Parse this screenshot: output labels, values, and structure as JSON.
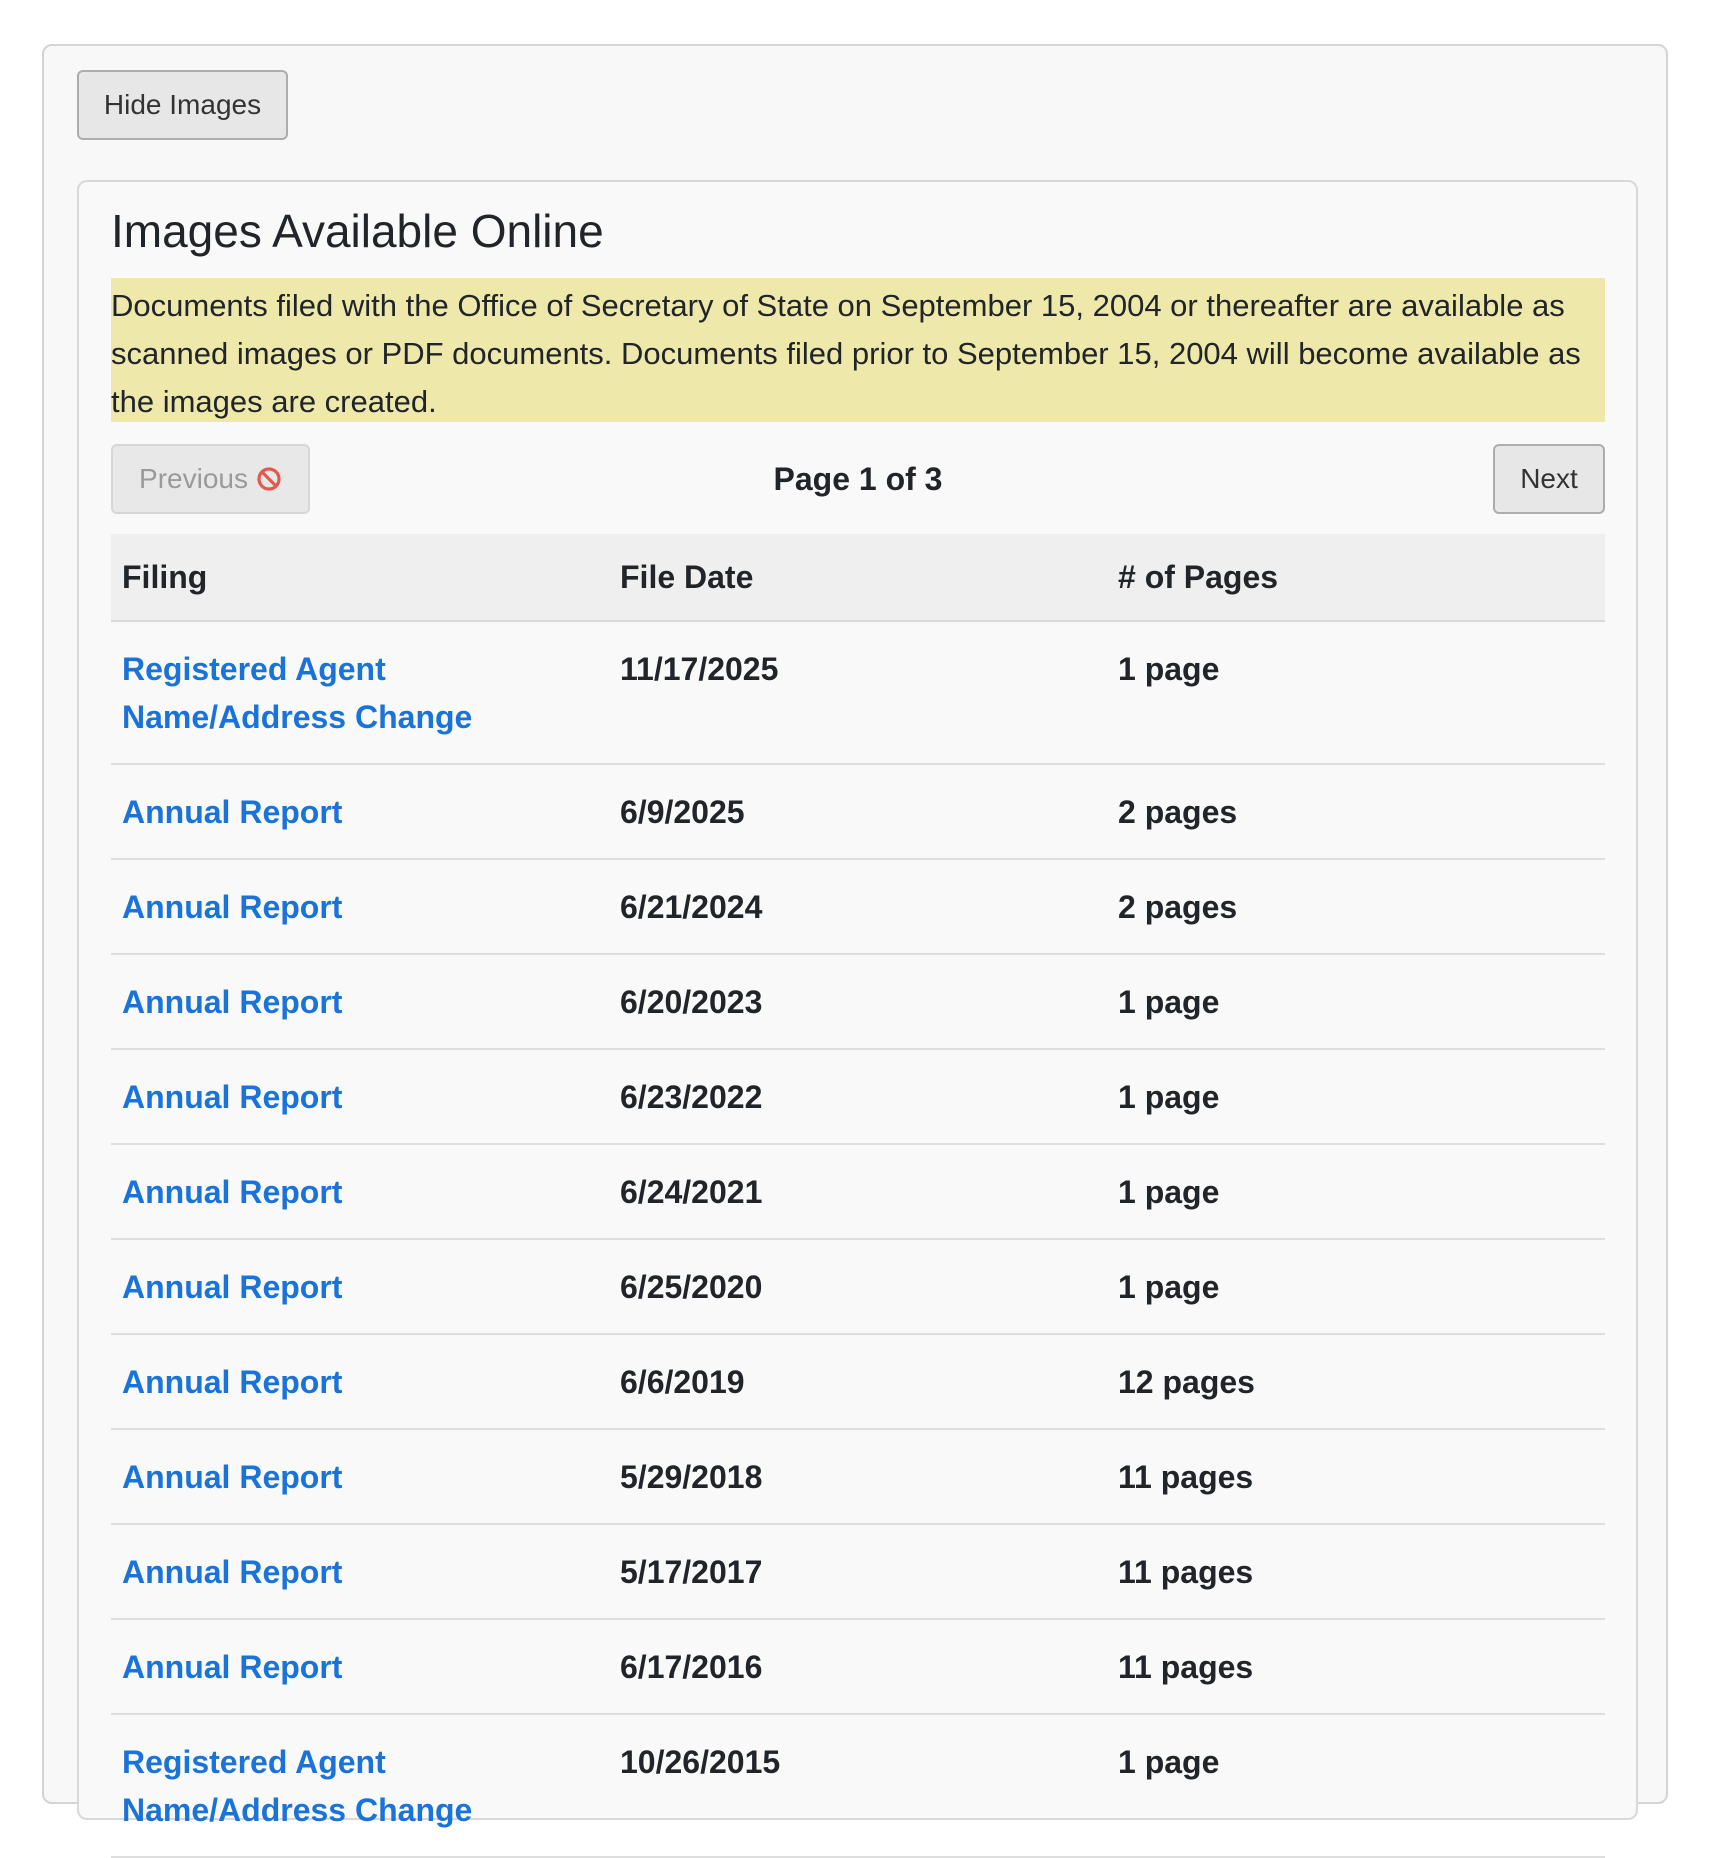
{
  "toolbar": {
    "hide_images_label": "Hide Images"
  },
  "card": {
    "title": "Images Available Online",
    "notice": "Documents filed with the Office of Secretary of State on September 15, 2004 or thereafter are available as scanned images or PDF documents. Documents filed prior to September 15, 2004 will become available as the images are created."
  },
  "pagination": {
    "previous_label": "Previous",
    "previous_icon": "prohibited-icon",
    "page_text": "Page 1 of 3",
    "next_label": "Next"
  },
  "colors": {
    "link": "#1a73d9",
    "notice_bg": "#eee8aa",
    "prohibited": "#e05a4f"
  },
  "table": {
    "headers": [
      "Filing",
      "File Date",
      "# of Pages"
    ],
    "rows": [
      {
        "filing": "Registered Agent Name/Address Change",
        "date": "11/17/2025",
        "pages": "1 page"
      },
      {
        "filing": "Annual Report",
        "date": "6/9/2025",
        "pages": "2 pages"
      },
      {
        "filing": "Annual Report",
        "date": "6/21/2024",
        "pages": "2 pages"
      },
      {
        "filing": "Annual Report",
        "date": "6/20/2023",
        "pages": "1 page"
      },
      {
        "filing": "Annual Report",
        "date": "6/23/2022",
        "pages": "1 page"
      },
      {
        "filing": "Annual Report",
        "date": "6/24/2021",
        "pages": "1 page"
      },
      {
        "filing": "Annual Report",
        "date": "6/25/2020",
        "pages": "1 page"
      },
      {
        "filing": "Annual Report",
        "date": "6/6/2019",
        "pages": "12 pages"
      },
      {
        "filing": "Annual Report",
        "date": "5/29/2018",
        "pages": "11 pages"
      },
      {
        "filing": "Annual Report",
        "date": "5/17/2017",
        "pages": "11 pages"
      },
      {
        "filing": "Annual Report",
        "date": "6/17/2016",
        "pages": "11 pages"
      },
      {
        "filing": "Registered Agent Name/Address Change",
        "date": "10/26/2015",
        "pages": "1 page"
      }
    ]
  }
}
